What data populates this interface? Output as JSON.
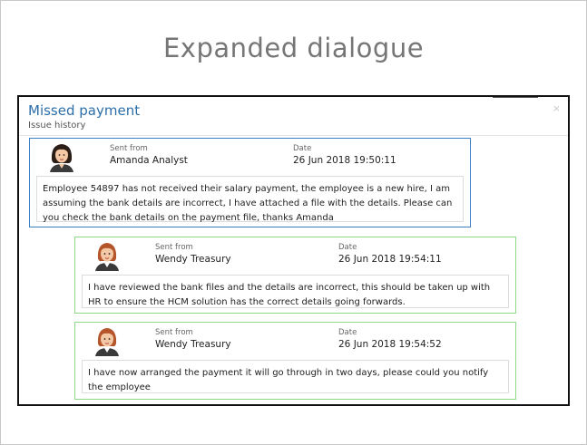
{
  "slide": {
    "title": "Expanded dialogue"
  },
  "dialog": {
    "title": "Missed payment",
    "subtitle": "Issue history",
    "close_glyph": "×"
  },
  "messages": [
    {
      "sent_from_label": "Sent from",
      "sender": "Amanda Analyst",
      "date_label": "Date",
      "date": "26 Jun 2018 19:50:11",
      "body": "Employee 54897 has not received their salary payment, the employee is a new hire, I am assuming the bank details are incorrect, I have attached a file with the details. Please can you check the bank details on the payment file, thanks Amanda",
      "border_color": "#3b7fc4"
    },
    {
      "sent_from_label": "Sent from",
      "sender": "Wendy Treasury",
      "date_label": "Date",
      "date": "26 Jun 2018 19:54:11",
      "body": "I have reviewed the bank files and the details are incorrect, this should be taken up with HR to ensure the HCM solution has the correct details going forwards.",
      "border_color": "#8ed88a"
    },
    {
      "sent_from_label": "Sent from",
      "sender": "Wendy Treasury",
      "date_label": "Date",
      "date": "26 Jun 2018 19:54:52",
      "body": "I have now arranged the payment it will go through in two days, please could you notify the employee",
      "border_color": "#8ed88a"
    }
  ]
}
